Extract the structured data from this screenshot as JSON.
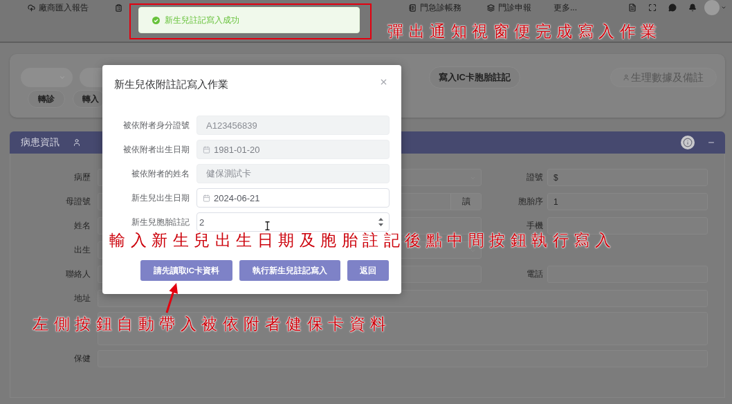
{
  "top_nav": {
    "items": [
      {
        "label": "廠商匯入報告"
      },
      {
        "label": "門急診帳務"
      },
      {
        "label": "門診申報"
      },
      {
        "label": "更多..."
      }
    ]
  },
  "toast": {
    "message": "新生兒註記寫入成功"
  },
  "toolbar": {
    "write_ic_button": "寫入IC卡胞胎註記",
    "vitals_button": "生理數據及備註",
    "buttons": [
      {
        "label": "轉診"
      },
      {
        "label": "轉入"
      }
    ]
  },
  "patient_panel": {
    "title": "病患資訊",
    "rows": [
      {
        "left": {
          "label": "病歷",
          "kind": "select"
        },
        "right": {
          "label": "證號",
          "kind": "text",
          "value": "$"
        }
      },
      {
        "left": {
          "label": "母證號",
          "kind": "button",
          "button": "讀"
        },
        "right": {
          "label": "胞胎序",
          "kind": "text",
          "value": "1"
        }
      },
      {
        "left": {
          "label": "姓名",
          "kind": "text"
        },
        "right": {
          "label": "手機",
          "kind": "text"
        }
      },
      {
        "left": {
          "label": "出生",
          "kind": "select"
        }
      },
      {
        "left": {
          "label": "聯絡人",
          "kind": "text"
        },
        "right": {
          "label": "電話",
          "kind": "text"
        }
      },
      {
        "full": {
          "label": "地址",
          "kind": "text"
        }
      },
      {
        "full": {
          "kind": "textarea"
        }
      },
      {
        "full": {
          "label": "保健",
          "kind": "text"
        }
      }
    ]
  },
  "modal": {
    "title": "新生兒依附註記寫入作業",
    "fields": [
      {
        "label": "被依附者身分證號",
        "kind": "text",
        "value": "A123456839",
        "disabled": true
      },
      {
        "label": "被依附者出生日期",
        "kind": "date",
        "value": "1981-01-20",
        "disabled": true
      },
      {
        "label": "被依附者的姓名",
        "kind": "text",
        "value": "健保測試卡",
        "disabled": true
      },
      {
        "label": "新生兒出生日期",
        "kind": "date",
        "value": "2024-06-21",
        "disabled": false
      },
      {
        "label": "新生兒胞胎註記",
        "kind": "number",
        "value": "2",
        "disabled": false
      }
    ],
    "buttons": [
      {
        "label": "請先讀取IC卡資料"
      },
      {
        "label": "執行新生兒註記寫入"
      },
      {
        "label": "返回"
      }
    ]
  },
  "annotations": [
    {
      "text": "彈出通知視窗便完成寫入作業"
    },
    {
      "text": "輸入新生兒出生日期及胞胎註記後點中間按鈕執行寫入"
    },
    {
      "text": "左側按鈕自動帶入被依附者健保卡資料"
    }
  ]
}
